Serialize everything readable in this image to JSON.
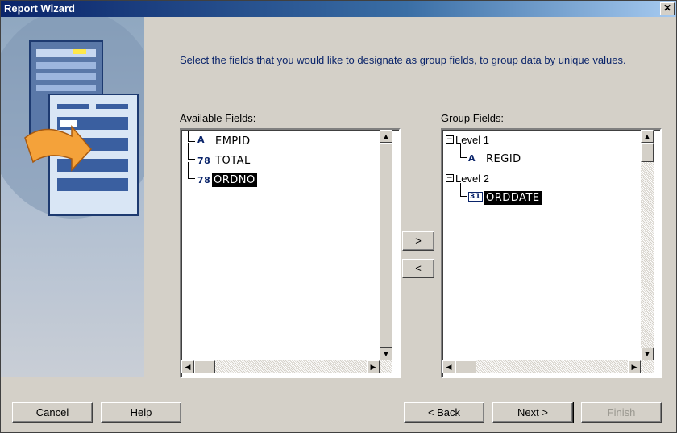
{
  "window": {
    "title": "Report Wizard",
    "close_glyph": "✕"
  },
  "instructions": "Select the fields that you would like to designate as group fields, to group data by unique values.",
  "available": {
    "label_accel": "A",
    "label_rest": "vailable Fields:",
    "items": [
      {
        "icon": "A",
        "name": "EMPID",
        "selected": false
      },
      {
        "icon": "78",
        "name": "TOTAL",
        "selected": false
      },
      {
        "icon": "78",
        "name": "ORDNO",
        "selected": true
      }
    ]
  },
  "group": {
    "label_accel": "G",
    "label_rest": "roup Fields:",
    "levels": [
      {
        "name": "Level 1",
        "expander": "−",
        "fields": [
          {
            "icon": "A",
            "name": "REGID",
            "selected": false
          }
        ]
      },
      {
        "name": "Level 2",
        "expander": "−",
        "fields": [
          {
            "icon": "31",
            "name": "ORDDATE",
            "selected": true
          }
        ]
      }
    ]
  },
  "move_buttons": {
    "add": ">",
    "remove": "<"
  },
  "footer": {
    "cancel": "Cancel",
    "help": "Help",
    "back": "< Back",
    "next": "Next >",
    "finish": "Finish"
  }
}
